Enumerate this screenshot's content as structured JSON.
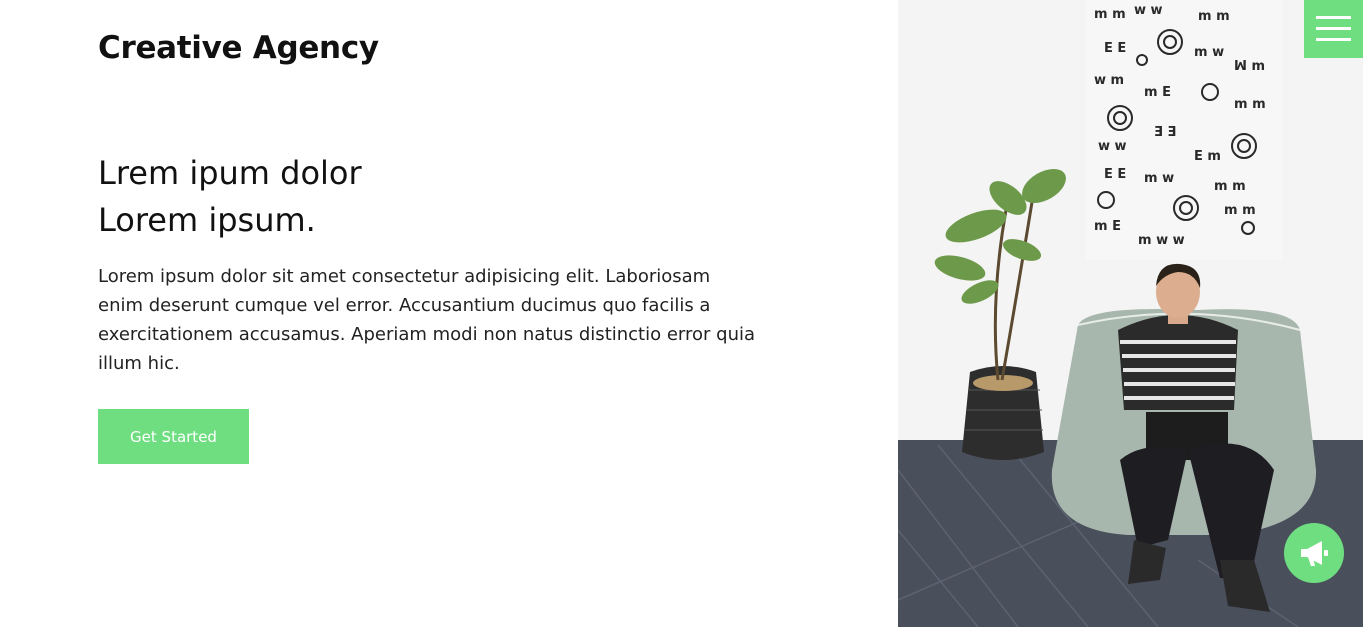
{
  "header": {
    "brand": "Creative Agency"
  },
  "hero": {
    "title_line1": "Lrem ipum dolor",
    "title_line2": "Lorem ipsum.",
    "body": "Lorem ipsum dolor sit amet consectetur adipisicing elit. Laboriosam enim deserunt cumque vel error. Accusantium ducimus quo facilis a exercitationem accusamus. Aperiam modi non natus distinctio error quia illum hic.",
    "cta_label": "Get Started"
  },
  "icons": {
    "menu": "hamburger-menu-icon",
    "fab": "megaphone-icon"
  },
  "colors": {
    "accent": "#6ede80",
    "text": "#111111",
    "background": "#ffffff"
  }
}
